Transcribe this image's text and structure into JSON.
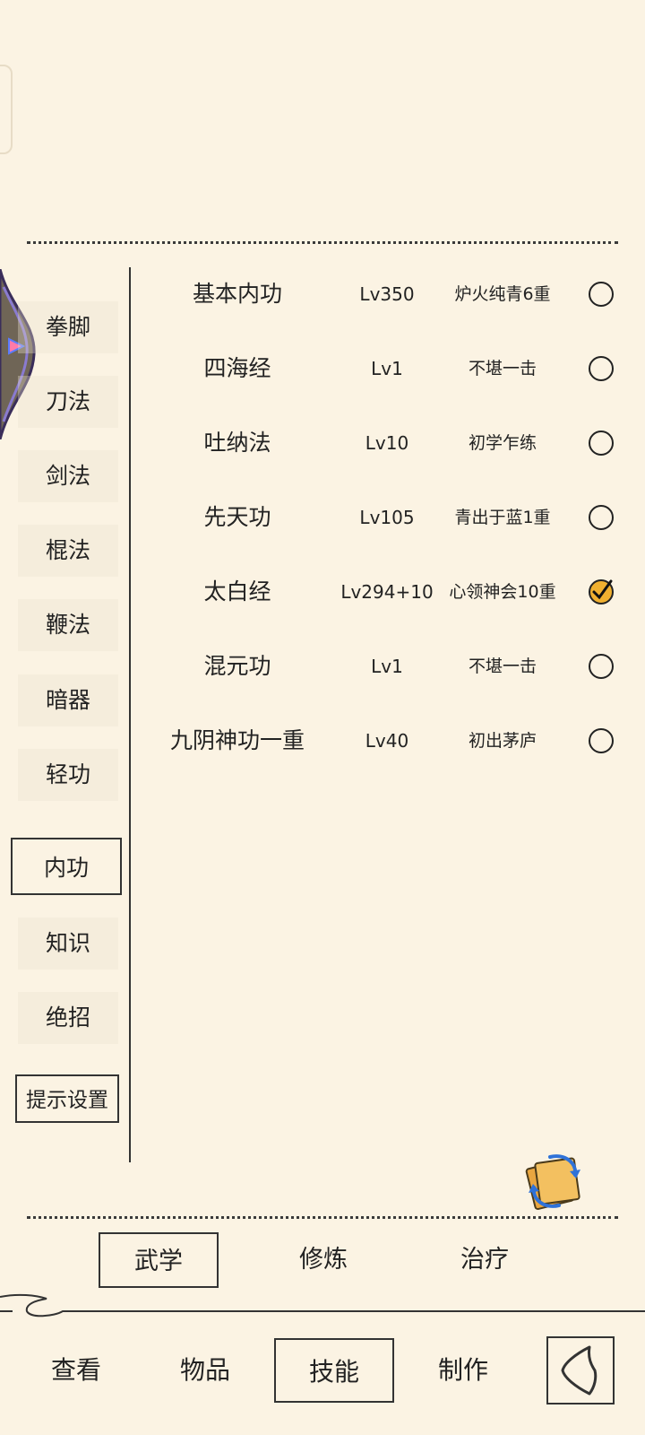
{
  "categories": [
    {
      "label": "拳脚",
      "selected": false
    },
    {
      "label": "刀法",
      "selected": false
    },
    {
      "label": "剑法",
      "selected": false
    },
    {
      "label": "棍法",
      "selected": false
    },
    {
      "label": "鞭法",
      "selected": false
    },
    {
      "label": "暗器",
      "selected": false
    },
    {
      "label": "轻功",
      "selected": false
    },
    {
      "label": "内功",
      "selected": true
    },
    {
      "label": "知识",
      "selected": false
    },
    {
      "label": "绝招",
      "selected": false
    }
  ],
  "hint_settings_label": "提示设置",
  "skills": [
    {
      "name": "基本内功",
      "level": "Lv350",
      "rank": "炉火纯青6重",
      "equipped": false
    },
    {
      "name": "四海经",
      "level": "Lv1",
      "rank": "不堪一击",
      "equipped": false
    },
    {
      "name": "吐纳法",
      "level": "Lv10",
      "rank": "初学乍练",
      "equipped": false
    },
    {
      "name": "先天功",
      "level": "Lv105",
      "rank": "青出于蓝1重",
      "equipped": false
    },
    {
      "name": "太白经",
      "level": "Lv294+10",
      "rank": "心领神会10重",
      "equipped": true
    },
    {
      "name": "混元功",
      "level": "Lv1",
      "rank": "不堪一击",
      "equipped": false
    },
    {
      "name": "九阴神功一重",
      "level": "Lv40",
      "rank": "初出茅庐",
      "equipped": false
    }
  ],
  "sub_tabs": [
    {
      "label": "武学",
      "selected": true
    },
    {
      "label": "修炼",
      "selected": false
    },
    {
      "label": "治疗",
      "selected": false
    }
  ],
  "nav_tabs": [
    {
      "label": "查看",
      "selected": false
    },
    {
      "label": "物品",
      "selected": false
    },
    {
      "label": "技能",
      "selected": true
    },
    {
      "label": "制作",
      "selected": false
    }
  ],
  "icons": {
    "refresh": "refresh-scroll-icon",
    "back": "back-icon",
    "check": "checkmark-icon",
    "expand": "expand-arrow-icon"
  },
  "colors": {
    "background": "#fbf3e3",
    "ink": "#222222",
    "check_fill": "#f0b030"
  }
}
